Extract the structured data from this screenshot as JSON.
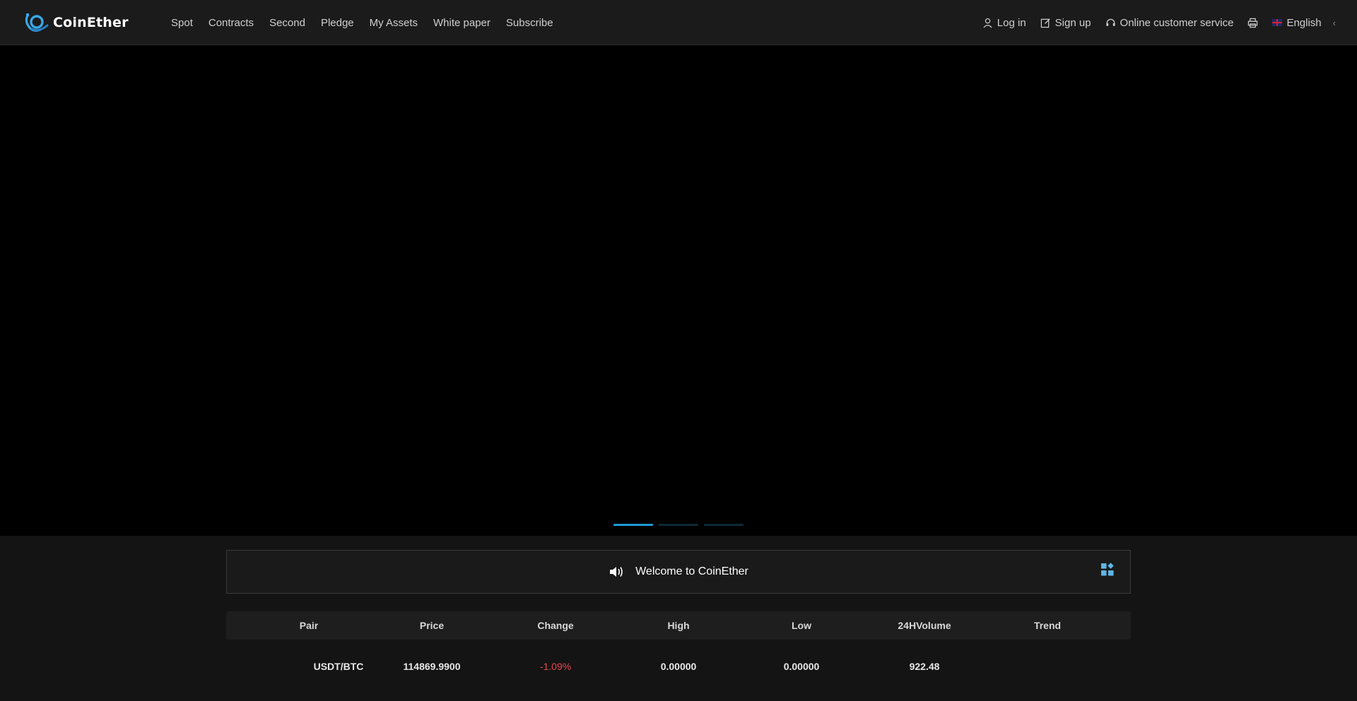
{
  "brand": {
    "name": "CoinEther"
  },
  "nav": {
    "items": [
      "Spot",
      "Contracts",
      "Second",
      "Pledge",
      "My Assets",
      "White paper",
      "Subscribe"
    ]
  },
  "account": {
    "login_label": "Log in",
    "signup_label": "Sign up",
    "service_label": "Online customer service",
    "language_label": "English"
  },
  "banner": {
    "slides_total": 3,
    "active_slide": 1
  },
  "notice": {
    "text": "Welcome to CoinEther"
  },
  "market": {
    "columns": [
      "Pair",
      "Price",
      "Change",
      "High",
      "Low",
      "24HVolume",
      "Trend"
    ],
    "rows": [
      {
        "pair": "USDT/BTC",
        "price": "114869.9900",
        "change": "-1.09%",
        "high": "0.00000",
        "low": "0.00000",
        "volume": "922.48",
        "trend": ""
      }
    ]
  },
  "colors": {
    "accent": "#1e9ad6",
    "negative": "#e5484d",
    "background": "#141414",
    "banner": "#000000"
  }
}
